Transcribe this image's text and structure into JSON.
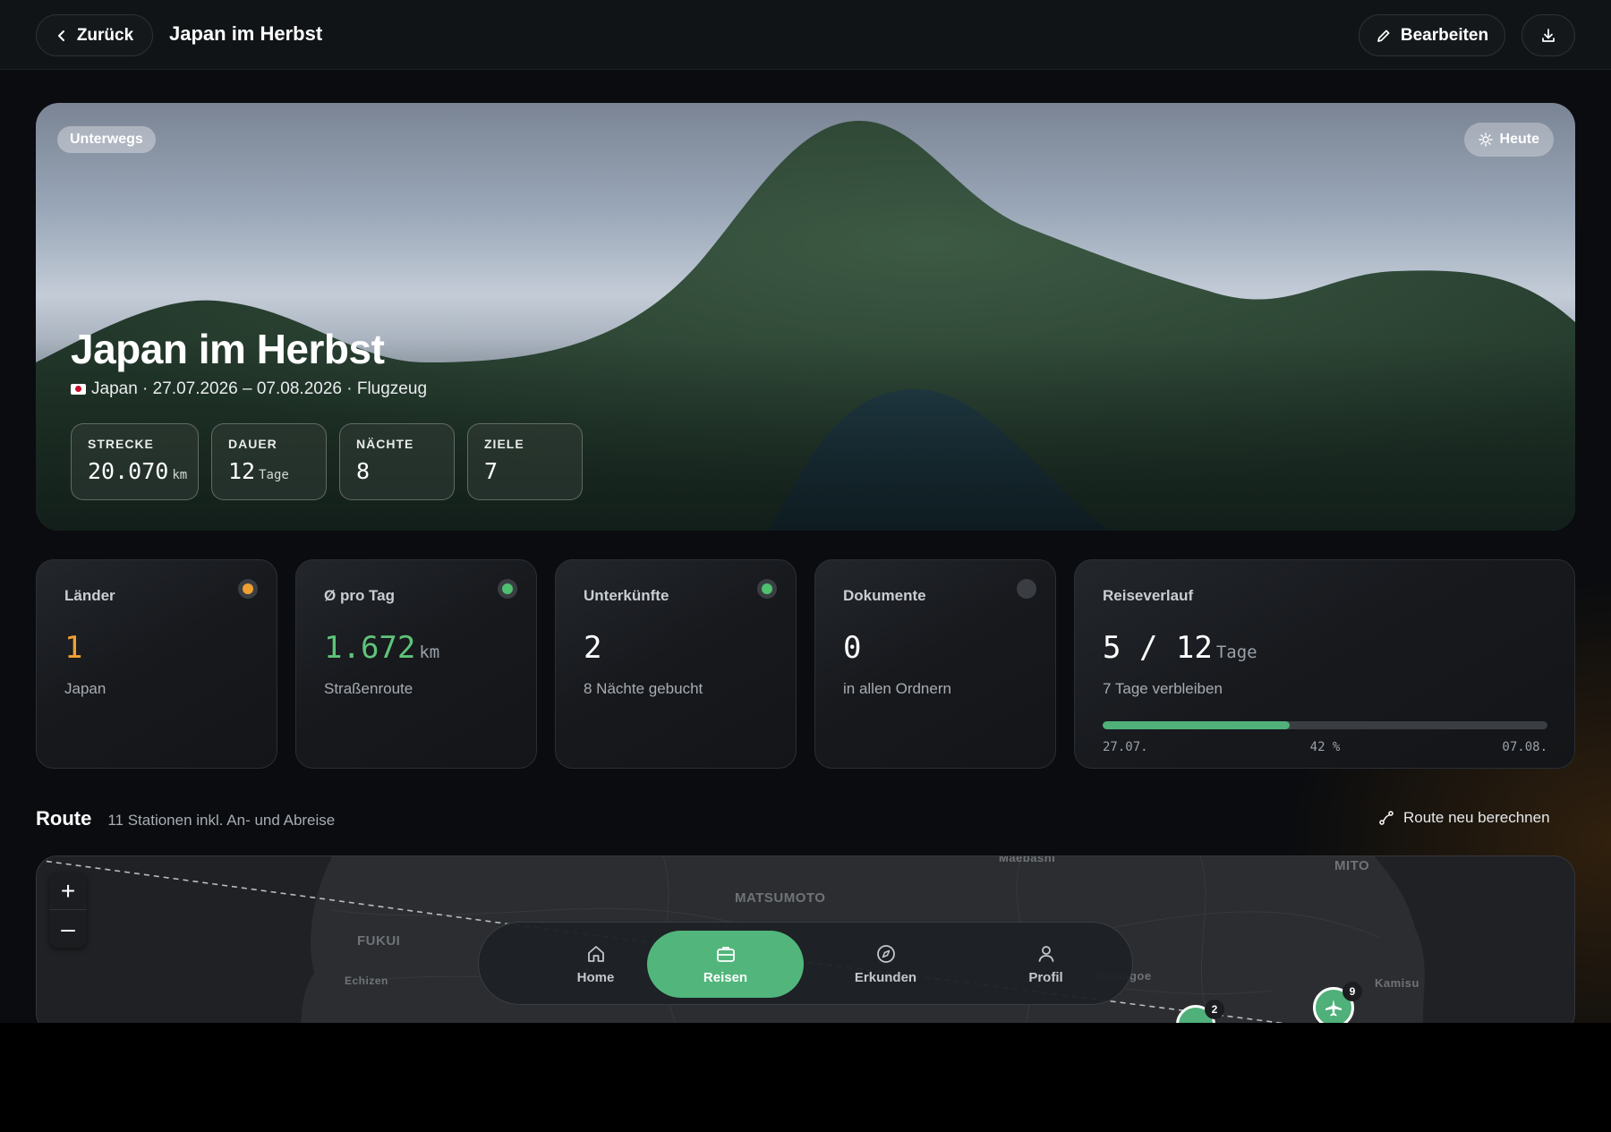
{
  "header": {
    "back_label": "Zurück",
    "title": "Japan im Herbst",
    "edit_label": "Bearbeiten",
    "download_icon": "download-icon"
  },
  "hero": {
    "status": "Unterwegs",
    "today_label": "Heute",
    "title": "Japan im Herbst",
    "subtitle": "Japan · 27.07.2026 – 07.08.2026 · Flugzeug",
    "stats": [
      {
        "label": "STRECKE",
        "value": "20.070",
        "unit": "km"
      },
      {
        "label": "DAUER",
        "value": "12",
        "unit": "Tage"
      },
      {
        "label": "NÄCHTE",
        "value": "8",
        "unit": ""
      },
      {
        "label": "ZIELE",
        "value": "7",
        "unit": ""
      }
    ]
  },
  "cards": [
    {
      "title": "Länder",
      "value": "1",
      "unit": "",
      "sub": "Japan",
      "dot_color": "#f0a030",
      "value_color": "#f0a030"
    },
    {
      "title": "Ø pro Tag",
      "value": "1.672",
      "unit": "km",
      "sub": "Straßenroute",
      "dot_color": "#4fc070",
      "value_color": "#5fc47a"
    },
    {
      "title": "Unterkünfte",
      "value": "2",
      "unit": "",
      "sub": "8 Nächte gebucht",
      "dot_color": "#4fc070",
      "value_color": "#ffffff"
    },
    {
      "title": "Dokumente",
      "value": "0",
      "unit": "",
      "sub": "in allen Ordnern",
      "dot_color": "#3a3e43",
      "value_color": "#ffffff"
    }
  ],
  "progress_card": {
    "title": "Reiseverlauf",
    "value": "5 / 12",
    "unit": "Tage",
    "sub": "7 Tage verbleiben",
    "progress": 0.42,
    "start": "27.07.",
    "percent": "42 %",
    "end": "07.08."
  },
  "route": {
    "title": "Route",
    "subtitle": "11 Stationen inkl. An- und Abreise",
    "recalc_label": "Route neu berechnen"
  },
  "map": {
    "labels": [
      "MATSUMOTO",
      "FUKUI",
      "Echizen",
      "MITO",
      "Maebashi",
      "Kawagoe",
      "Kamisu"
    ],
    "zoom_in": "+",
    "zoom_out": "–",
    "markers": [
      "2",
      "9"
    ]
  },
  "nav": [
    {
      "label": "Home",
      "icon": "home-icon",
      "active": false
    },
    {
      "label": "Reisen",
      "icon": "briefcase-icon",
      "active": true
    },
    {
      "label": "Erkunden",
      "icon": "compass-icon",
      "active": false
    },
    {
      "label": "Profil",
      "icon": "user-icon",
      "active": false
    }
  ]
}
